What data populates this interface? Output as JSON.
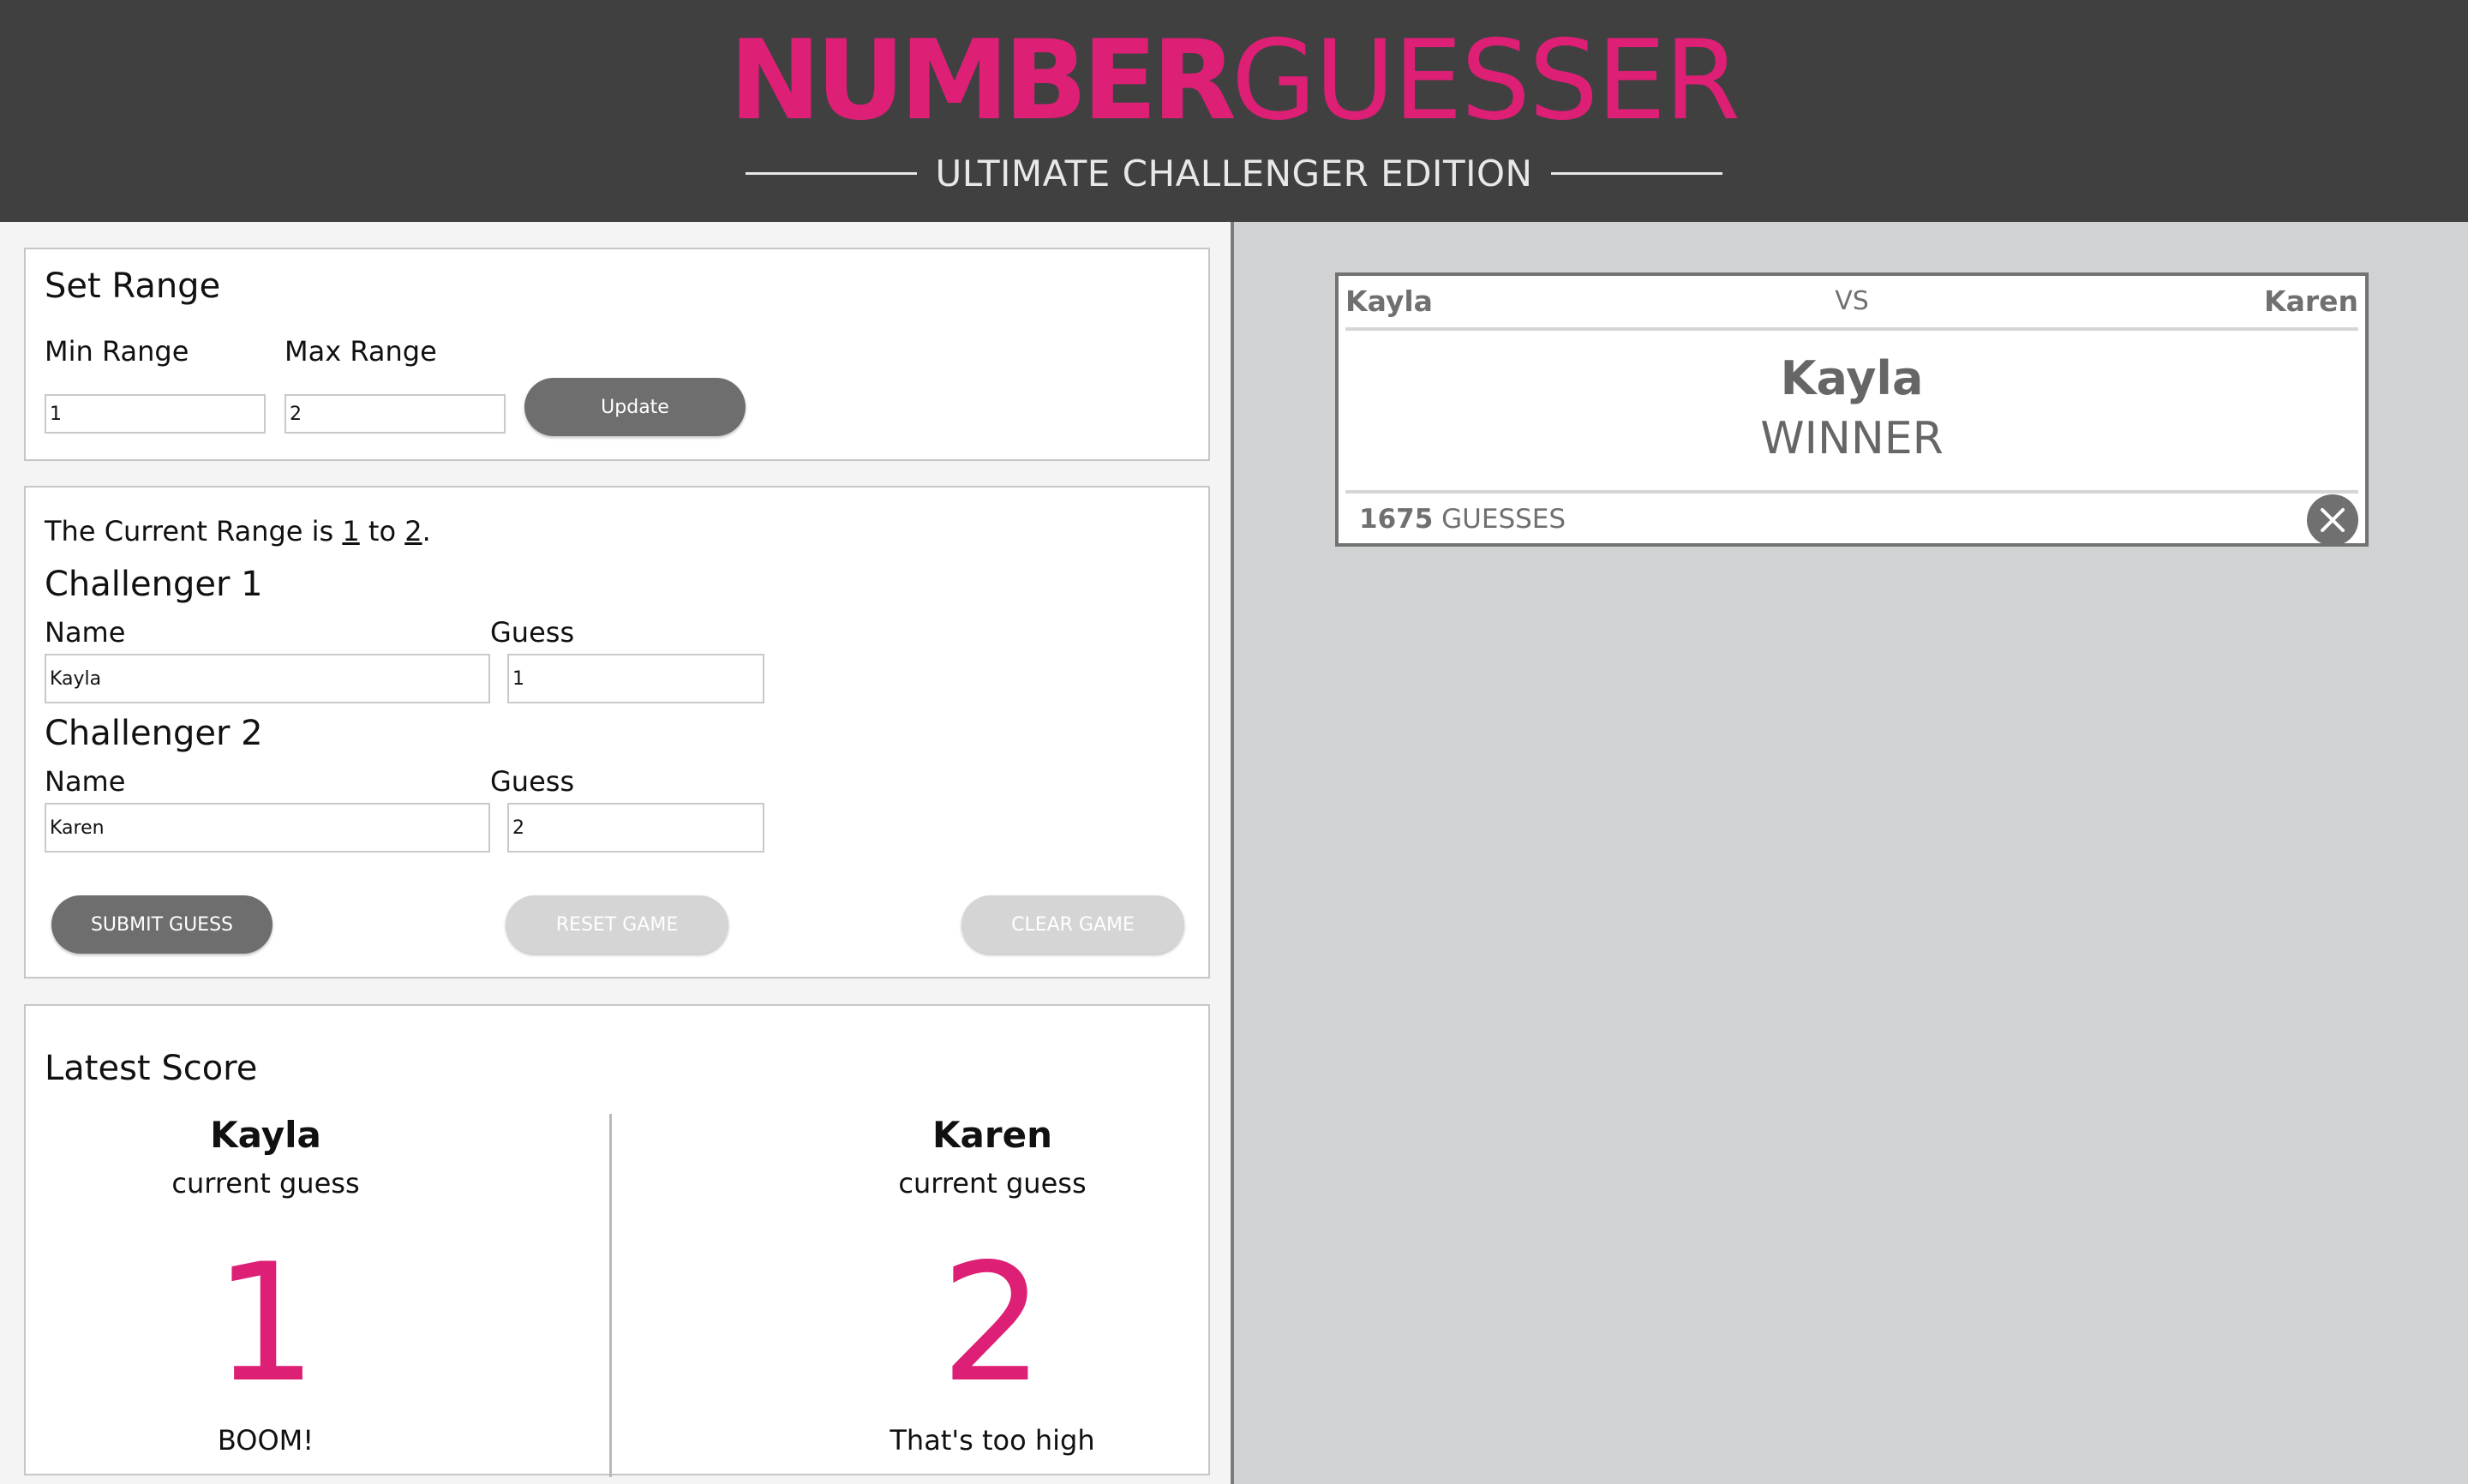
{
  "header": {
    "title_bold": "NUMBER",
    "title_light": "GUESSER",
    "subtitle": "ULTIMATE CHALLENGER EDITION"
  },
  "set_range": {
    "title": "Set Range",
    "min_label": "Min Range",
    "max_label": "Max Range",
    "min_value": "1",
    "max_value": "2",
    "update_label": "Update"
  },
  "current_range": {
    "prefix": "The Current Range is ",
    "min": "1",
    "middle": " to ",
    "max": "2",
    "suffix": "."
  },
  "challengers": [
    {
      "title": "Challenger 1",
      "name_label": "Name",
      "guess_label": "Guess",
      "name_value": "Kayla",
      "guess_value": "1"
    },
    {
      "title": "Challenger 2",
      "name_label": "Name",
      "guess_label": "Guess",
      "name_value": "Karen",
      "guess_value": "2"
    }
  ],
  "buttons": {
    "submit": "SUBMIT GUESS",
    "reset": "RESET GAME",
    "clear": "CLEAR GAME"
  },
  "latest_score": {
    "title": "Latest Score",
    "players": [
      {
        "name": "Kayla",
        "caption": "current guess",
        "guess": "1",
        "message": "BOOM!"
      },
      {
        "name": "Karen",
        "caption": "current guess",
        "guess": "2",
        "message": "That's too high"
      }
    ]
  },
  "result_card": {
    "player1": "Kayla",
    "vs": "VS",
    "player2": "Karen",
    "winner_name": "Kayla",
    "winner_label": "WINNER",
    "guess_count": "1675",
    "guess_label": "GUESSES",
    "close_icon": "close-icon"
  },
  "colors": {
    "accent": "#dd1f75",
    "header_bg": "#404041",
    "dark_button": "#6e6e6f",
    "disabled_button": "#d5d5d6",
    "right_panel_bg": "#d1d2d4"
  }
}
